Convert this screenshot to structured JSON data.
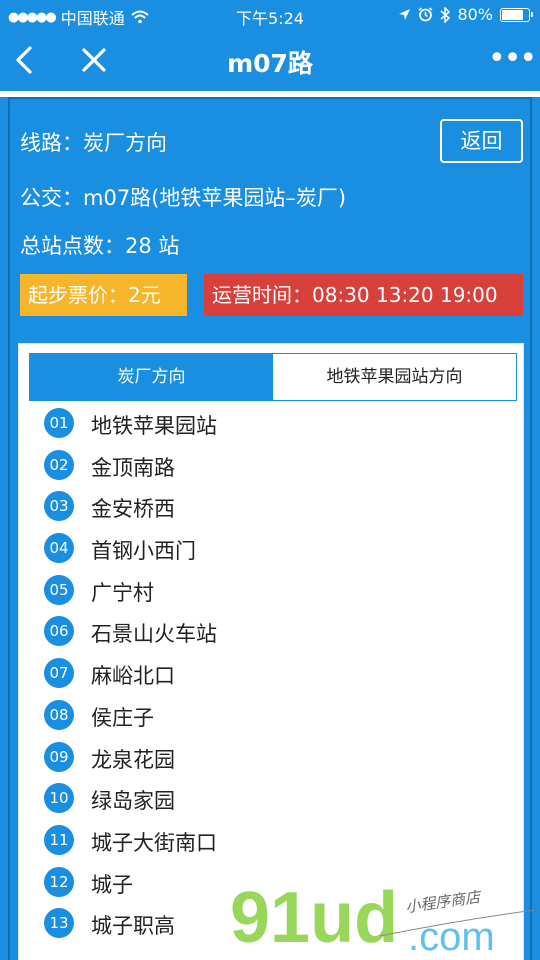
{
  "status_bar": {
    "signal_dots": "●●●●●",
    "carrier": "中国联通",
    "time": "下午5:24",
    "battery_text": "80%",
    "battery_level": 0.8
  },
  "navbar": {
    "title": "m07路",
    "more_label": "•••"
  },
  "info": {
    "route_line": "线路：炭厂方向",
    "back_label": "返回",
    "bus_line": "公交：m07路(地铁苹果园站–炭厂)",
    "total_stops": "总站点数：28 站",
    "fare": "起步票价：2元",
    "hours": "运营时间：08:30 13:20 19:00"
  },
  "colors": {
    "primary": "#1a8ee0",
    "fare_bg": "#f7b52c",
    "hours_bg": "#d8403c"
  },
  "tabs": [
    {
      "label": "炭厂方向",
      "active": true
    },
    {
      "label": "地铁苹果园站方向",
      "active": false
    }
  ],
  "stops": [
    {
      "num": "01",
      "name": "地铁苹果园站"
    },
    {
      "num": "02",
      "name": "金顶南路"
    },
    {
      "num": "03",
      "name": "金安桥西"
    },
    {
      "num": "04",
      "name": "首钢小西门"
    },
    {
      "num": "05",
      "name": "广宁村"
    },
    {
      "num": "06",
      "name": "石景山火车站"
    },
    {
      "num": "07",
      "name": "麻峪北口"
    },
    {
      "num": "08",
      "name": "侯庄子"
    },
    {
      "num": "09",
      "name": "龙泉花园"
    },
    {
      "num": "10",
      "name": "绿岛家园"
    },
    {
      "num": "11",
      "name": "城子大街南口"
    },
    {
      "num": "12",
      "name": "城子"
    },
    {
      "num": "13",
      "name": "城子职高"
    }
  ],
  "watermark": {
    "brand": "91ud",
    "suffix": ".com",
    "tagline": "小程序商店"
  }
}
